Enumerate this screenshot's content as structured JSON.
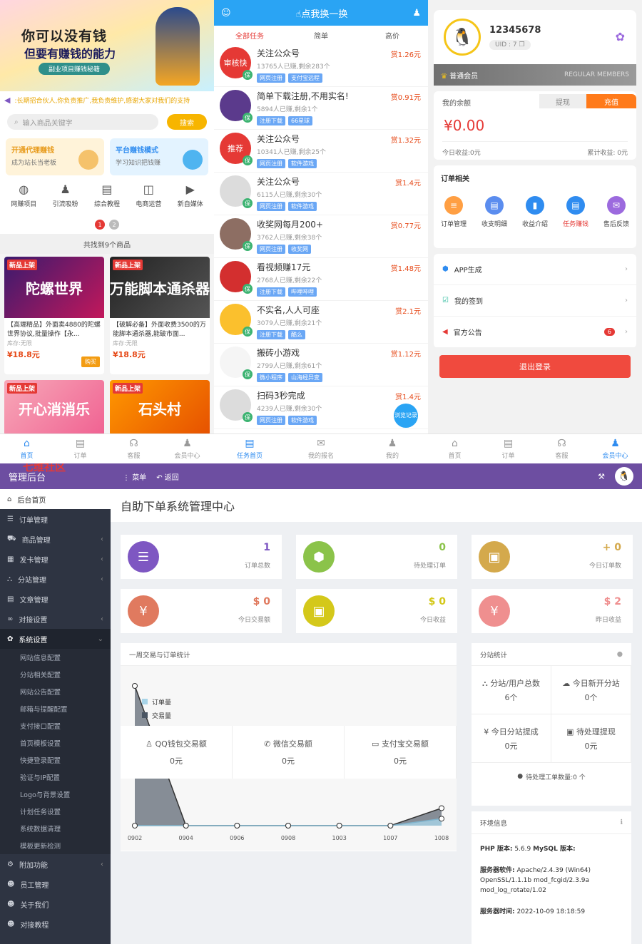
{
  "p1": {
    "banner": {
      "line1": "你可以没有钱",
      "line2": "但要有赚钱的能力",
      "tag": "副业项目赚钱秘籍"
    },
    "notice": ":长期招合伙人,你负责推广,我负责维护,感谢大家对我们的支持",
    "search": {
      "placeholder": "输入商品关键字",
      "button": "搜索"
    },
    "promos": [
      {
        "title": "开通代理赚钱",
        "sub": "成为站长当老板",
        "bg": "#fff3d9",
        "tc": "#e89b1c",
        "ic": "#f5c26b"
      },
      {
        "title": "平台赚钱模式",
        "sub": "学习知识把钱赚",
        "bg": "#e3f3ff",
        "tc": "#2f8cf0",
        "ic": "#4fb4f0"
      }
    ],
    "cats": [
      {
        "label": "网赚项目",
        "icon": "globe-icon",
        "g": "◍"
      },
      {
        "label": "引流吸粉",
        "icon": "user-icon",
        "g": "♟"
      },
      {
        "label": "综合教程",
        "icon": "book-icon",
        "g": "▤"
      },
      {
        "label": "电商运营",
        "icon": "shop-icon",
        "g": "◫"
      },
      {
        "label": "新自媒体",
        "icon": "video-icon",
        "g": "▶"
      }
    ],
    "pages": [
      "1",
      "2"
    ],
    "found": "共找到9个商品",
    "goods": [
      {
        "badge": "新品上架",
        "img": "陀螺世界",
        "bg": "linear-gradient(135deg,#3a1a6e,#c2185b)",
        "name": "【高端精品】外面卖4880的陀螺世界协议,批量操作【永...",
        "stock": "库存:无限",
        "price": "¥18.8元",
        "buy": "购买"
      },
      {
        "badge": "新品上架",
        "img": "万能脚本通杀器",
        "bg": "linear-gradient(135deg,#222,#555)",
        "name": "【破解必备】外面收费3500的万能脚本通杀器,能破市面...",
        "stock": "库存:无限",
        "price": "¥18.8元",
        "buy": ""
      },
      {
        "badge": "新品上架",
        "img": "开心消消乐",
        "bg": "linear-gradient(135deg,#f7a8b8,#f06292)",
        "name": "",
        "stock": "",
        "price": "",
        "buy": ""
      },
      {
        "badge": "新品上架",
        "img": "石头村",
        "bg": "linear-gradient(135deg,#ff9800,#e65100)",
        "name": "",
        "stock": "",
        "price": "",
        "buy": ""
      }
    ],
    "tabs": [
      {
        "label": "首页",
        "icon": "home-icon",
        "g": "⌂",
        "on": true
      },
      {
        "label": "订单",
        "icon": "order-icon",
        "g": "▤",
        "on": false
      },
      {
        "label": "客服",
        "icon": "service-icon",
        "g": "☊",
        "on": false
      },
      {
        "label": "会员中心",
        "icon": "member-icon",
        "g": "♟",
        "on": false
      }
    ]
  },
  "p2": {
    "title": "点我换一换",
    "tabs": [
      "全部任务",
      "简单",
      "高价"
    ],
    "tasks": [
      {
        "title": "关注公众号",
        "meta": "13765人已赚,剩余283个",
        "tags": [
          "网页注册",
          "支付宝远程"
        ],
        "reward": "赏1.26元",
        "av": "审核快",
        "avbg": "#e53935"
      },
      {
        "title": "简单下载注册,不用实名!",
        "meta": "5894人已赚,剩余1个",
        "tags": [
          "注册下载",
          "66星球"
        ],
        "reward": "赏0.91元",
        "av": "",
        "avbg": "#5b3a8c"
      },
      {
        "title": "关注公众号",
        "meta": "10341人已赚,剩余25个",
        "tags": [
          "网页注册",
          "软件游戏"
        ],
        "reward": "赏1.32元",
        "av": "推荐",
        "avbg": "#e53935"
      },
      {
        "title": "关注公众号",
        "meta": "6115人已赚,剩余30个",
        "tags": [
          "网页注册",
          "软件游戏"
        ],
        "reward": "赏1.4元",
        "av": "",
        "avbg": "#dcdcdc"
      },
      {
        "title": "收奖网每月200+",
        "meta": "3762人已赚,剩余38个",
        "tags": [
          "网页注册",
          "收奖网"
        ],
        "reward": "赏0.77元",
        "av": "",
        "avbg": "#8d6e63"
      },
      {
        "title": "看视频赚17元",
        "meta": "2768人已赚,剩余22个",
        "tags": [
          "注册下载",
          "哔哩哔哩"
        ],
        "reward": "赏1.48元",
        "av": "",
        "avbg": "#d32f2f"
      },
      {
        "title": "不实名,人人可座",
        "meta": "3079人已赚,剩余21个",
        "tags": [
          "注册下载",
          "酷么"
        ],
        "reward": "赏2.1元",
        "av": "",
        "avbg": "#fbc02d"
      },
      {
        "title": "搬砖小游戏",
        "meta": "2799人已赚,剩余61个",
        "tags": [
          "微小程序",
          "山海经异变"
        ],
        "reward": "赏1.12元",
        "av": "",
        "avbg": "#f5f5f5"
      },
      {
        "title": "扫码3秒完成",
        "meta": "4239人已赚,剩余30个",
        "tags": [
          "网页注册",
          "软件游戏"
        ],
        "reward": "赏1.4元",
        "av": "",
        "avbg": "#dcdcdc"
      }
    ],
    "bao": "保",
    "float": "浏览记录",
    "bottom": [
      {
        "label": "任务首页",
        "icon": "task-home-icon",
        "g": "▤",
        "on": true
      },
      {
        "label": "我的报名",
        "icon": "signup-icon",
        "g": "✉",
        "on": false
      },
      {
        "label": "我的",
        "icon": "user-icon",
        "g": "♟",
        "on": false
      }
    ]
  },
  "p3": {
    "name": "12345678",
    "uid": "UID : 7",
    "member": "普通会员",
    "member_en": "REGULAR MEMBERS",
    "balance_label": "我的余额",
    "withdraw": "提现",
    "recharge": "充值",
    "amount": "¥0.00",
    "today": "今日收益:0元",
    "total": "累计收益: 0元",
    "orders_title": "订单相关",
    "order_icons": [
      {
        "label": "订单管理",
        "c": "#ff9f43",
        "icon": "order-manage-icon",
        "g": "≡"
      },
      {
        "label": "收支明细",
        "c": "#5b8def",
        "icon": "detail-icon",
        "g": "▤"
      },
      {
        "label": "收益介绍",
        "c": "#2f8cf0",
        "icon": "chart-icon",
        "g": "▮"
      },
      {
        "label": "任务赚钱",
        "c": "#2f8cf0",
        "icon": "task-icon",
        "g": "▤",
        "red": true
      },
      {
        "label": "售后反馈",
        "c": "#9c6ade",
        "icon": "feedback-icon",
        "g": "✉"
      }
    ],
    "menu": [
      {
        "label": "APP生成",
        "icon": "cube-icon",
        "g": "⬢",
        "c": "#2f8cf0",
        "badge": ""
      },
      {
        "label": "我的签到",
        "icon": "calendar-icon",
        "g": "☑",
        "c": "#26b99a",
        "badge": ""
      },
      {
        "label": "官方公告",
        "icon": "megaphone-icon",
        "g": "◀",
        "c": "#e53935",
        "badge": "6"
      }
    ],
    "logout": "退出登录",
    "tabs": [
      {
        "label": "首页",
        "icon": "home-icon",
        "g": "⌂",
        "on": false
      },
      {
        "label": "订单",
        "icon": "order-icon",
        "g": "▤",
        "on": false
      },
      {
        "label": "客服",
        "icon": "service-icon",
        "g": "☊",
        "on": false
      },
      {
        "label": "会员中心",
        "icon": "member-icon",
        "g": "♟",
        "on": true
      }
    ]
  },
  "admin": {
    "watermark": "七维社区",
    "brand": "管理后台",
    "menu": "菜单",
    "back": "返回",
    "sidebar": [
      {
        "label": "后台首页",
        "icon": "home-icon",
        "g": "⌂",
        "state": "act",
        "chev": ""
      },
      {
        "label": "订单管理",
        "icon": "list-icon",
        "g": "☰",
        "state": "",
        "chev": ""
      },
      {
        "label": "商品管理",
        "icon": "cart-icon",
        "g": "⛟",
        "state": "",
        "chev": "‹"
      },
      {
        "label": "发卡管理",
        "icon": "grid-icon",
        "g": "▦",
        "state": "",
        "chev": "‹"
      },
      {
        "label": "分站管理",
        "icon": "sitemap-icon",
        "g": "⛬",
        "state": "",
        "chev": "‹"
      },
      {
        "label": "文章管理",
        "icon": "doc-icon",
        "g": "▤",
        "state": "",
        "chev": ""
      },
      {
        "label": "对接设置",
        "icon": "link-icon",
        "g": "∞",
        "state": "",
        "chev": "‹"
      },
      {
        "label": "系统设置",
        "icon": "gear-icon",
        "g": "✿",
        "state": "open",
        "chev": "⌄"
      }
    ],
    "submenu": [
      "网站信息配置",
      "分站相关配置",
      "网站公告配置",
      "邮箱与提醒配置",
      "支付接口配置",
      "首页模板设置",
      "快捷登录配置",
      "验证与IP配置",
      "Logo与背景设置",
      "计划任务设置",
      "系统数据清理",
      "模板更新检测"
    ],
    "sidebar2": [
      {
        "label": "附加功能",
        "icon": "plugin-icon",
        "g": "⚙",
        "chev": "‹"
      },
      {
        "label": "员工管理",
        "icon": "staff-icon",
        "g": "☻",
        "chev": ""
      },
      {
        "label": "关于我们",
        "icon": "info-icon",
        "g": "☻",
        "chev": ""
      },
      {
        "label": "对接教程",
        "icon": "tutorial-icon",
        "g": "☻",
        "chev": ""
      }
    ],
    "title": "自助下单系统管理中心",
    "stats": [
      {
        "value": "1",
        "label": "订单总数",
        "c": "#7e57c2",
        "icon": "list-numbered-icon",
        "g": "☰"
      },
      {
        "value": "0",
        "label": "待处理订单",
        "c": "#8bc34a",
        "icon": "cube-icon",
        "g": "⬢"
      },
      {
        "value": "+ 0",
        "label": "今日订单数",
        "c": "#d4a94c",
        "icon": "briefcase-icon",
        "g": "▣"
      },
      {
        "value": "$ 0",
        "label": "今日交易额",
        "c": "#e07a5f",
        "icon": "yen-icon",
        "g": "¥"
      },
      {
        "value": "$ 0",
        "label": "今日收益",
        "c": "#d4c81a",
        "icon": "briefcase-icon",
        "g": "▣"
      },
      {
        "value": "$ 2",
        "label": "昨日收益",
        "c": "#ef8f8f",
        "icon": "yen-icon",
        "g": "¥"
      }
    ],
    "chart_box_title": "一周交易与订单统计",
    "pay": [
      {
        "label": "QQ钱包交易额",
        "icon": "qq-icon",
        "g": "♙",
        "value": "0元"
      },
      {
        "label": "微信交易额",
        "icon": "wechat-icon",
        "g": "✆",
        "value": "0元"
      },
      {
        "label": "支付宝交易额",
        "icon": "card-icon",
        "g": "▭",
        "value": "0元"
      }
    ],
    "fz_title": "分站统计",
    "fz": [
      {
        "label": "分站/用户总数",
        "icon": "sitemap-icon",
        "g": "⛬",
        "value": "6个"
      },
      {
        "label": "今日新开分站",
        "icon": "cloud-icon",
        "g": "☁",
        "value": "0个"
      },
      {
        "label": "今日分站提成",
        "icon": "yen-icon",
        "g": "¥",
        "value": "0元"
      },
      {
        "label": "待处理提现",
        "icon": "money-icon",
        "g": "▣",
        "value": "0元"
      }
    ],
    "ticket": "待处理工单数量:0 个",
    "env_title": "环境信息",
    "env": {
      "php": "PHP 版本:",
      "php_v": "5.6.9",
      "mysql": "MySQL 版本:",
      "server": "服务器软件:",
      "server_v": "Apache/2.4.39 (Win64) OpenSSL/1.1.1b mod_fcgid/2.3.9a mod_log_rotate/1.02",
      "time": "服务器时间:",
      "time_v": "2022-10-09 18:18:59"
    }
  },
  "chart_data": {
    "type": "area",
    "title": "",
    "categories": [
      "0902",
      "0904",
      "0906",
      "0908",
      "1003",
      "1007",
      "1008"
    ],
    "series": [
      {
        "name": "订单量",
        "values": [
          0,
          0,
          0,
          0,
          0,
          0,
          0.1
        ],
        "color": "#a8d4e8"
      },
      {
        "name": "交易量",
        "values": [
          2,
          0,
          0,
          0,
          0,
          0,
          0.25
        ],
        "color": "#4a5563"
      }
    ],
    "ylim": [
      0,
      2
    ],
    "grid": false,
    "legend": "top-left"
  }
}
